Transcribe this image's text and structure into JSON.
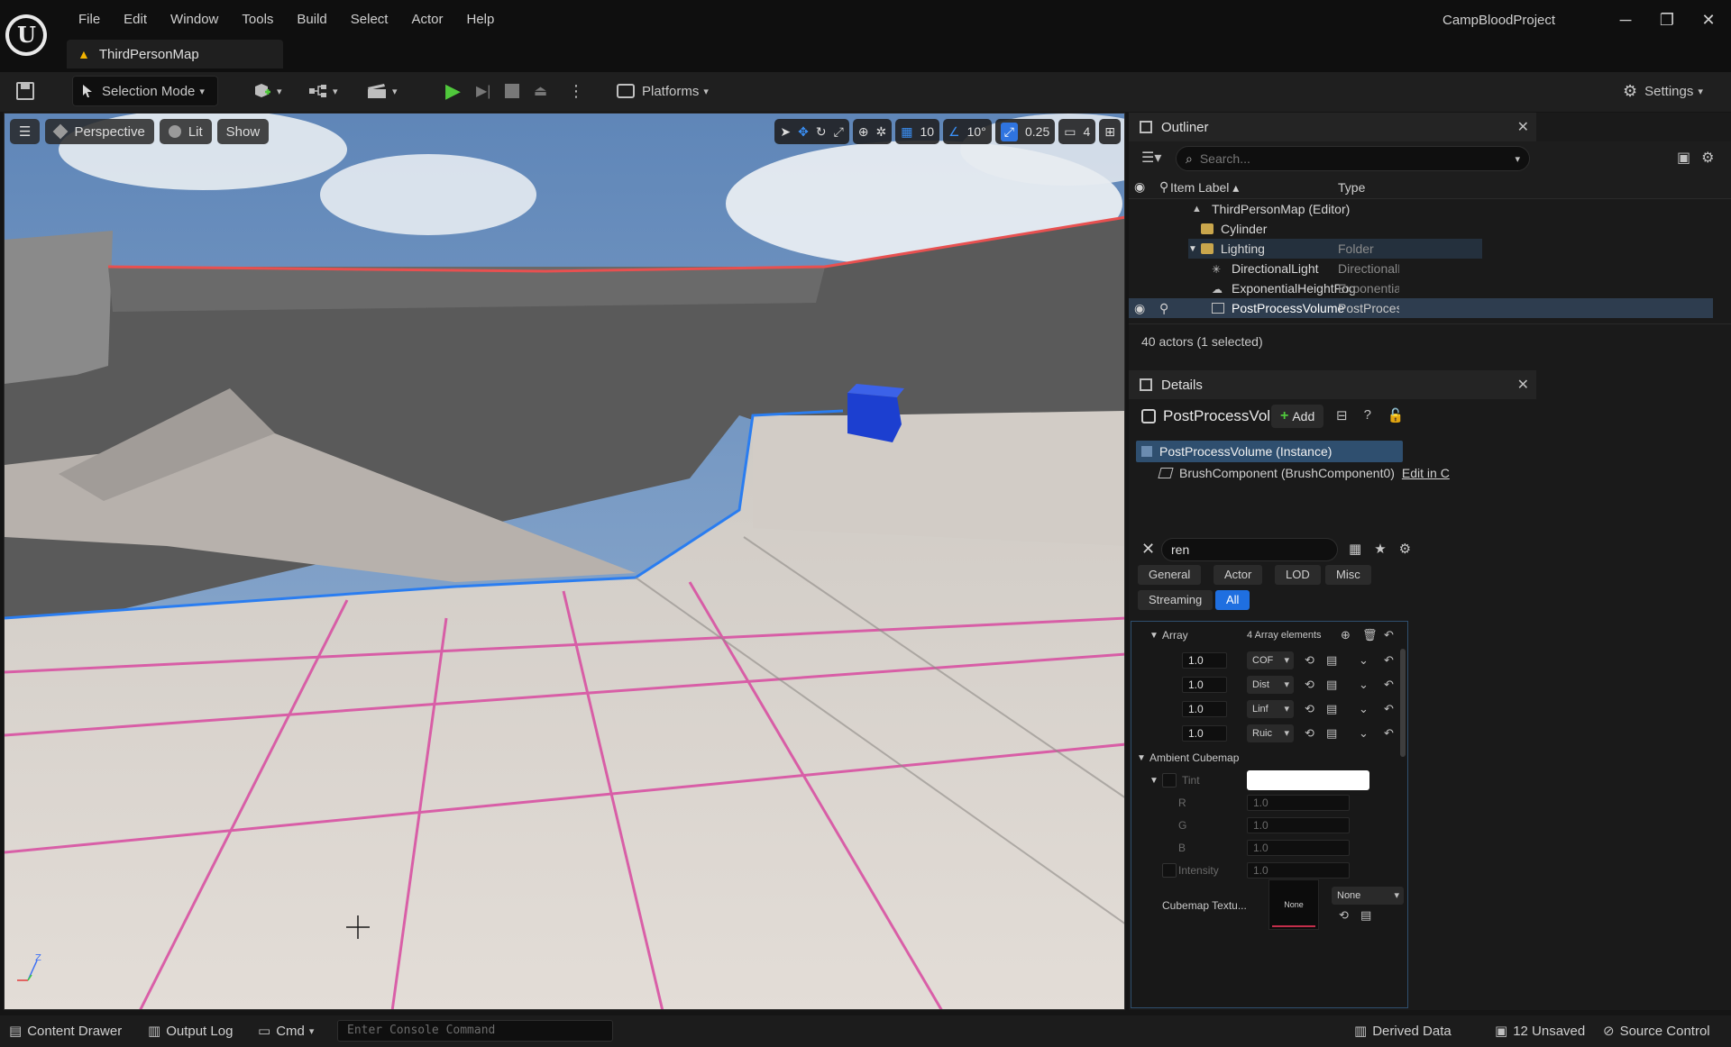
{
  "app": {
    "logo_letter": "U",
    "menu": [
      "File",
      "Edit",
      "Window",
      "Tools",
      "Build",
      "Select",
      "Actor",
      "Help"
    ],
    "map_tab": "ThirdPersonMap",
    "project_name": "CampBloodProject",
    "window_controls": {
      "minimize": "─",
      "restore": "❐",
      "close": "✕"
    }
  },
  "toolbar": {
    "selection_mode_label": "Selection Mode",
    "platforms_label": "Platforms",
    "settings_label": "Settings"
  },
  "viewport": {
    "menu_icon": "hamburger-icon",
    "perspective_label": "Perspective",
    "lit_label": "Lit",
    "show_label": "Show",
    "grid_snap": "10",
    "rotation_snap": "10°",
    "scale_snap": "0.25",
    "camera_speed": "4",
    "axis_z": "Z"
  },
  "outliner": {
    "title": "Outliner",
    "search_placeholder": "Search...",
    "col_label": "Item Label",
    "col_type": "Type",
    "rows": [
      {
        "label": "ThirdPersonMap (Editor)",
        "type": ""
      },
      {
        "label": "Cylinder",
        "type": ""
      },
      {
        "label": "Lighting",
        "type": "Folder"
      },
      {
        "label": "DirectionalLight",
        "type": "DirectionalL"
      },
      {
        "label": "ExponentialHeightFog",
        "type": "ExponentialI"
      },
      {
        "label": "PostProcessVolume",
        "type": "PostProcess"
      }
    ],
    "status": "40 actors (1 selected)"
  },
  "details": {
    "title": "Details",
    "actor_name": "PostProcessVolume",
    "add_label": "Add",
    "instance_label": "PostProcessVolume (Instance)",
    "brush_label": "BrushComponent (BrushComponent0)",
    "edit_link": "Edit in C",
    "search_value": "ren",
    "filters": [
      "General",
      "Actor",
      "LOD",
      "Misc",
      "Streaming",
      "All"
    ],
    "array_label": "Array",
    "array_count": "4 Array elements",
    "array_items": [
      {
        "value": "1.0",
        "type": "COF"
      },
      {
        "value": "1.0",
        "type": "Dist"
      },
      {
        "value": "1.0",
        "type": "Linf"
      },
      {
        "value": "1.0",
        "type": "Ruic"
      }
    ],
    "ambient_cubemap_label": "Ambient Cubemap",
    "tint_label": "Tint",
    "tint_color": "#ffffff",
    "r_label": "R",
    "r_value": "1.0",
    "g_label": "G",
    "g_value": "1.0",
    "b_label": "B",
    "b_value": "1.0",
    "intensity_label": "Intensity",
    "intensity_value": "1.0",
    "cubemap_label": "Cubemap Textu...",
    "cubemap_thumb": "None",
    "cubemap_value": "None"
  },
  "statusbar": {
    "content_drawer": "Content Drawer",
    "output_log": "Output Log",
    "cmd": "Cmd",
    "console_placeholder": "Enter Console Command",
    "derived_data": "Derived Data",
    "unsaved": "12 Unsaved",
    "source_control": "Source Control"
  },
  "colors": {
    "accent": "#1f6fe0",
    "play_green": "#50c83c",
    "selection_row": "#2e3d4f"
  }
}
